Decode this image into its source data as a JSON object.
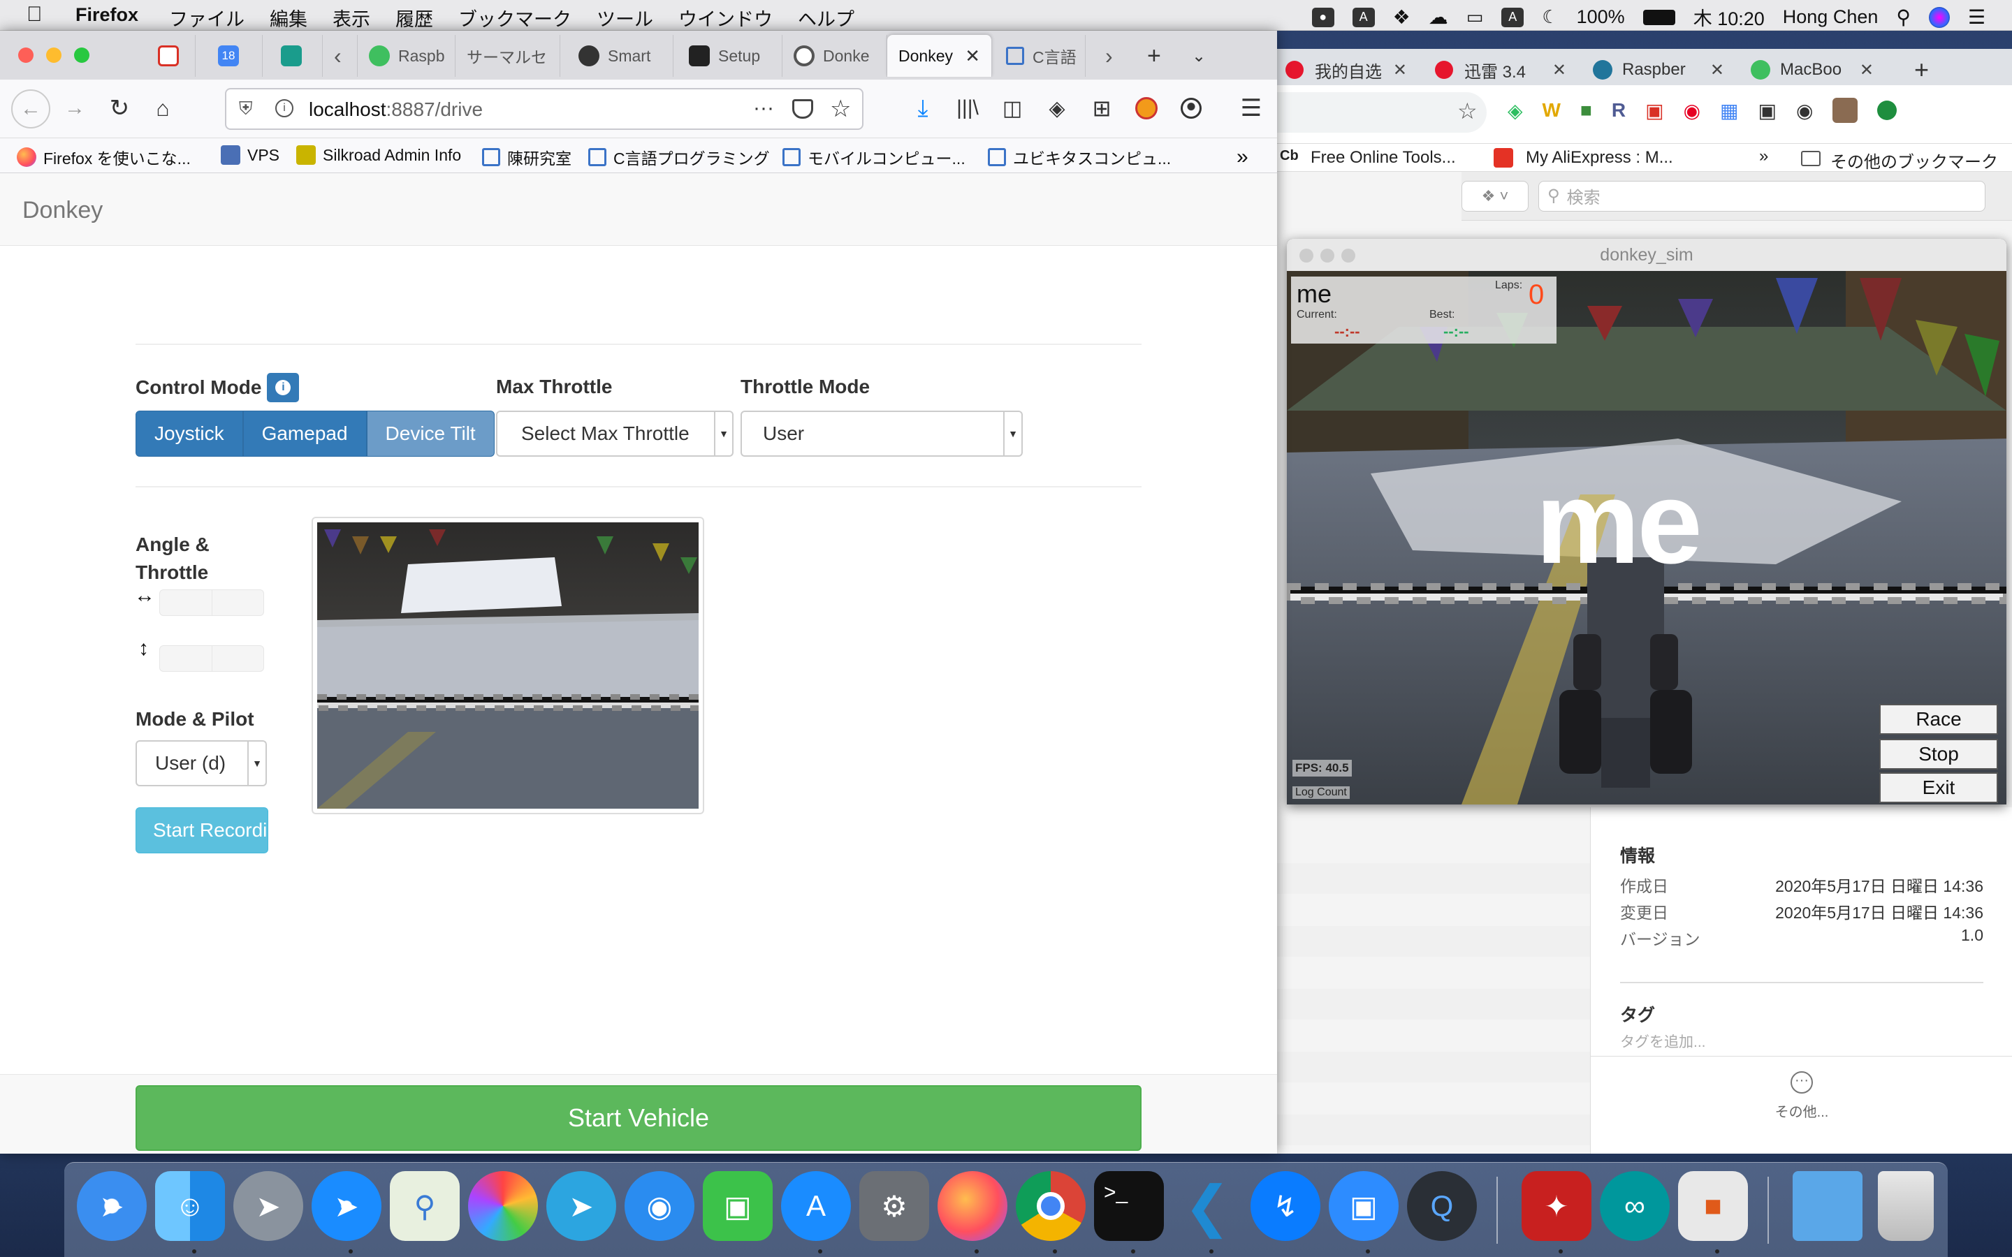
{
  "menubar": {
    "app": "Firefox",
    "menus": [
      "ファイル",
      "編集",
      "表示",
      "履歴",
      "ブックマーク",
      "ツール",
      "ウインドウ",
      "ヘルプ"
    ],
    "battery": "100%",
    "clock": "木 10:20",
    "user": "Hong Chen"
  },
  "firefox": {
    "tabs": [
      {
        "label": "Raspb"
      },
      {
        "label": "サーマルセ"
      },
      {
        "label": "Smart"
      },
      {
        "label": "Setup"
      },
      {
        "label": "Donke"
      },
      {
        "label": "Donkey"
      },
      {
        "label": "C言語"
      }
    ],
    "calendar_day": "18",
    "url_host": "localhost",
    "url_path": ":8887/drive",
    "bookmarks": [
      "Firefox を使いこな...",
      "VPS",
      "Silkroad Admin Info",
      "陳研究室",
      "C言語プログラミング",
      "モバイルコンピュー...",
      "ユビキタスコンピュ..."
    ]
  },
  "page": {
    "brand": "Donkey",
    "control_mode_label": "Control Mode",
    "control_modes": [
      "Joystick",
      "Gamepad",
      "Device Tilt"
    ],
    "max_throttle_label": "Max Throttle",
    "max_throttle_value": "Select Max Throttle",
    "throttle_mode_label": "Throttle Mode",
    "throttle_mode_value": "User",
    "angle_throttle_label": "Angle &\nThrottle",
    "mode_pilot_label": "Mode & Pilot",
    "mode_pilot_value": "User (d)",
    "start_recording": "Start Recording",
    "start_vehicle": "Start Vehicle"
  },
  "chrome": {
    "tabs": [
      {
        "label": "我的自选"
      },
      {
        "label": "迅雷 3.4"
      },
      {
        "label": "Raspber"
      },
      {
        "label": "MacBoo"
      }
    ],
    "bookmarks": [
      "Free Online Tools...",
      "My AliExpress : M...",
      "»",
      "その他のブックマーク"
    ],
    "search_placeholder": "検索",
    "info": {
      "heading": "情報",
      "rows": [
        {
          "k": "作成日",
          "v": "2020年5月17日 日曜日 14:36"
        },
        {
          "k": "変更日",
          "v": "2020年5月17日 日曜日 14:36"
        },
        {
          "k": "バージョン",
          "v": "1.0"
        }
      ],
      "tags_heading": "タグ",
      "tags_placeholder": "タグを追加...",
      "more": "その他..."
    }
  },
  "sim": {
    "title": "donkey_sim",
    "player": "me",
    "laps_label": "Laps:",
    "laps": "0",
    "current_label": "Current:",
    "best_label": "Best:",
    "current_time": "--:--",
    "best_time": "--:--",
    "overlay_name": "me",
    "fps": "FPS: 40.5",
    "log_count": "Log Count",
    "buttons": [
      "Race",
      "Stop",
      "Exit"
    ]
  },
  "colors": {
    "primary": "#337ab7",
    "info": "#5bc0de",
    "success": "#5cb85c",
    "laps": "#ff4a1a"
  }
}
